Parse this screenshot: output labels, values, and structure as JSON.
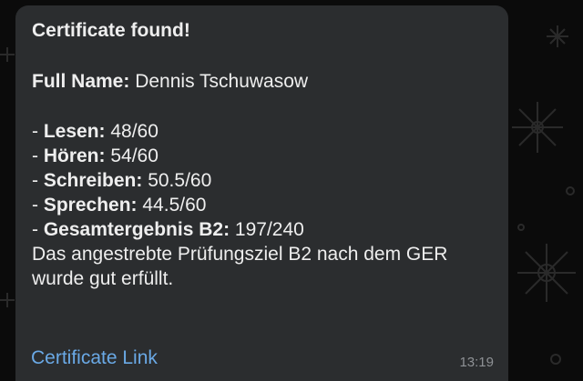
{
  "message": {
    "title": "Certificate found!",
    "full_name_label": "Full Name:",
    "full_name_value": "Dennis Tschuwasow",
    "scores": [
      {
        "prefix": "- ",
        "label": "Lesen:",
        "value": "48/60"
      },
      {
        "prefix": "- ",
        "label": "Hören:",
        "value": "54/60"
      },
      {
        "prefix": "- ",
        "label": "Schreiben:",
        "value": "50.5/60"
      },
      {
        "prefix": "- ",
        "label": "Sprechen:",
        "value": "44.5/60"
      },
      {
        "prefix": "- ",
        "label": "Gesamtergebnis B2:",
        "value": "197/240"
      }
    ],
    "description_line1": "Das angestrebte Prüfungsziel B2 nach dem GER",
    "description_line2": "wurde gut erfüllt.",
    "link_label": "Certificate Link",
    "timestamp": "13:19"
  },
  "colors": {
    "background": "#0b0b0b",
    "bubble": "#2b2d2f",
    "text": "#eeeeee",
    "link": "#6aa9e6",
    "timestamp": "#8e9195"
  }
}
